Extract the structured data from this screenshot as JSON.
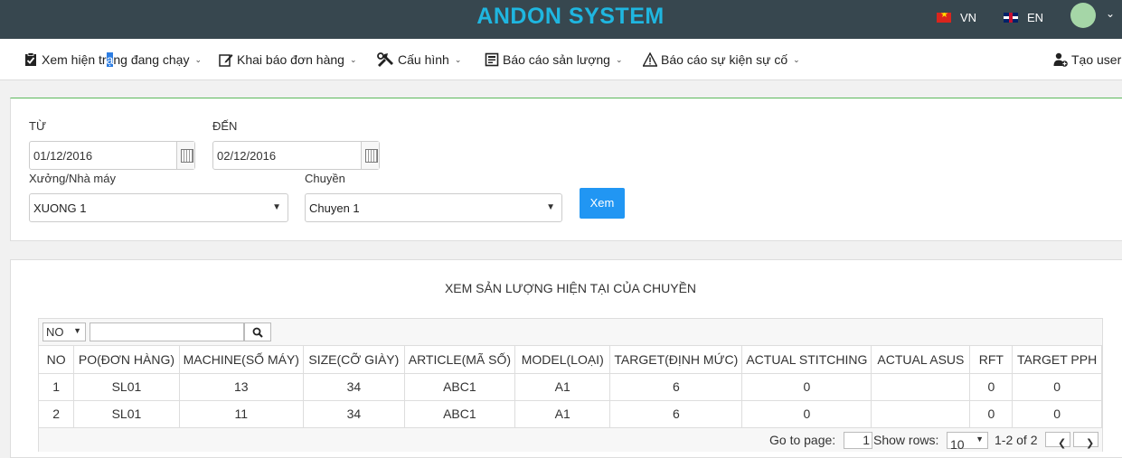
{
  "header": {
    "title": "ANDON SYSTEM",
    "lang_vn": "VN",
    "lang_en": "EN",
    "accent": "#1fb6e0",
    "bar_color": "#37474f"
  },
  "nav": {
    "items": [
      {
        "label_pre": "Xem hiện tr",
        "label_sel": "ạ",
        "label_post": "ng đang chạy",
        "icon": "clipboard-check-icon"
      },
      {
        "label": "Khai báo đơn hàng",
        "icon": "edit-icon"
      },
      {
        "label": "Cấu hình",
        "icon": "tools-icon"
      },
      {
        "label": "Báo cáo sản lượng",
        "icon": "report-icon"
      },
      {
        "label": "Báo cáo sự kiện sự cố",
        "icon": "warning-icon"
      }
    ],
    "create_user": "Tạo user"
  },
  "filters": {
    "from_label": "TỪ",
    "from_value": "01/12/2016",
    "to_label": "ĐẾN",
    "to_value": "02/12/2016",
    "factory_label": "Xưởng/Nhà máy",
    "factory_value": "XUONG 1",
    "line_label": "Chuyền",
    "line_value": "Chuyen 1",
    "submit_label": "Xem"
  },
  "report": {
    "title": "XEM SẢN LƯỢNG HIỆN TẠI CỦA CHUYỀN",
    "search_column": "NO",
    "columns": [
      "NO",
      "PO(ĐƠN HÀNG)",
      "MACHINE(SỐ MÁY)",
      "SIZE(CỠ GIÀY)",
      "ARTICLE(MÃ SỐ)",
      "MODEL(LOẠI)",
      "TARGET(ĐỊNH MỨC)",
      "ACTUAL STITCHING",
      "ACTUAL ASUS",
      "RFT",
      "TARGET PPH"
    ],
    "rows": [
      [
        "1",
        "SL01",
        "13",
        "34",
        "ABC1",
        "A1",
        "6",
        "0",
        "",
        "0",
        "0"
      ],
      [
        "2",
        "SL01",
        "11",
        "34",
        "ABC1",
        "A1",
        "6",
        "0",
        "",
        "0",
        "0"
      ]
    ],
    "pager": {
      "goto_label": "Go to page:",
      "page_value": "1",
      "show_rows_label": "Show rows:",
      "rows_value": "10",
      "range": "1-2 of 2"
    }
  }
}
